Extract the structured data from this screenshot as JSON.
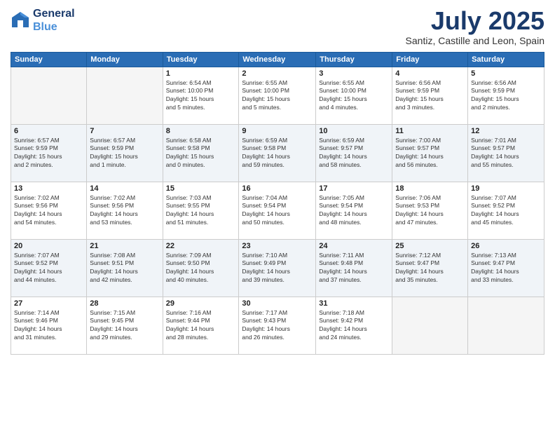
{
  "header": {
    "logo_line1": "General",
    "logo_line2": "Blue",
    "month_title": "July 2025",
    "location": "Santiz, Castille and Leon, Spain"
  },
  "weekdays": [
    "Sunday",
    "Monday",
    "Tuesday",
    "Wednesday",
    "Thursday",
    "Friday",
    "Saturday"
  ],
  "weeks": [
    [
      {
        "day": "",
        "info": ""
      },
      {
        "day": "",
        "info": ""
      },
      {
        "day": "1",
        "info": "Sunrise: 6:54 AM\nSunset: 10:00 PM\nDaylight: 15 hours\nand 5 minutes."
      },
      {
        "day": "2",
        "info": "Sunrise: 6:55 AM\nSunset: 10:00 PM\nDaylight: 15 hours\nand 5 minutes."
      },
      {
        "day": "3",
        "info": "Sunrise: 6:55 AM\nSunset: 10:00 PM\nDaylight: 15 hours\nand 4 minutes."
      },
      {
        "day": "4",
        "info": "Sunrise: 6:56 AM\nSunset: 9:59 PM\nDaylight: 15 hours\nand 3 minutes."
      },
      {
        "day": "5",
        "info": "Sunrise: 6:56 AM\nSunset: 9:59 PM\nDaylight: 15 hours\nand 2 minutes."
      }
    ],
    [
      {
        "day": "6",
        "info": "Sunrise: 6:57 AM\nSunset: 9:59 PM\nDaylight: 15 hours\nand 2 minutes."
      },
      {
        "day": "7",
        "info": "Sunrise: 6:57 AM\nSunset: 9:59 PM\nDaylight: 15 hours\nand 1 minute."
      },
      {
        "day": "8",
        "info": "Sunrise: 6:58 AM\nSunset: 9:58 PM\nDaylight: 15 hours\nand 0 minutes."
      },
      {
        "day": "9",
        "info": "Sunrise: 6:59 AM\nSunset: 9:58 PM\nDaylight: 14 hours\nand 59 minutes."
      },
      {
        "day": "10",
        "info": "Sunrise: 6:59 AM\nSunset: 9:57 PM\nDaylight: 14 hours\nand 58 minutes."
      },
      {
        "day": "11",
        "info": "Sunrise: 7:00 AM\nSunset: 9:57 PM\nDaylight: 14 hours\nand 56 minutes."
      },
      {
        "day": "12",
        "info": "Sunrise: 7:01 AM\nSunset: 9:57 PM\nDaylight: 14 hours\nand 55 minutes."
      }
    ],
    [
      {
        "day": "13",
        "info": "Sunrise: 7:02 AM\nSunset: 9:56 PM\nDaylight: 14 hours\nand 54 minutes."
      },
      {
        "day": "14",
        "info": "Sunrise: 7:02 AM\nSunset: 9:56 PM\nDaylight: 14 hours\nand 53 minutes."
      },
      {
        "day": "15",
        "info": "Sunrise: 7:03 AM\nSunset: 9:55 PM\nDaylight: 14 hours\nand 51 minutes."
      },
      {
        "day": "16",
        "info": "Sunrise: 7:04 AM\nSunset: 9:54 PM\nDaylight: 14 hours\nand 50 minutes."
      },
      {
        "day": "17",
        "info": "Sunrise: 7:05 AM\nSunset: 9:54 PM\nDaylight: 14 hours\nand 48 minutes."
      },
      {
        "day": "18",
        "info": "Sunrise: 7:06 AM\nSunset: 9:53 PM\nDaylight: 14 hours\nand 47 minutes."
      },
      {
        "day": "19",
        "info": "Sunrise: 7:07 AM\nSunset: 9:52 PM\nDaylight: 14 hours\nand 45 minutes."
      }
    ],
    [
      {
        "day": "20",
        "info": "Sunrise: 7:07 AM\nSunset: 9:52 PM\nDaylight: 14 hours\nand 44 minutes."
      },
      {
        "day": "21",
        "info": "Sunrise: 7:08 AM\nSunset: 9:51 PM\nDaylight: 14 hours\nand 42 minutes."
      },
      {
        "day": "22",
        "info": "Sunrise: 7:09 AM\nSunset: 9:50 PM\nDaylight: 14 hours\nand 40 minutes."
      },
      {
        "day": "23",
        "info": "Sunrise: 7:10 AM\nSunset: 9:49 PM\nDaylight: 14 hours\nand 39 minutes."
      },
      {
        "day": "24",
        "info": "Sunrise: 7:11 AM\nSunset: 9:48 PM\nDaylight: 14 hours\nand 37 minutes."
      },
      {
        "day": "25",
        "info": "Sunrise: 7:12 AM\nSunset: 9:47 PM\nDaylight: 14 hours\nand 35 minutes."
      },
      {
        "day": "26",
        "info": "Sunrise: 7:13 AM\nSunset: 9:47 PM\nDaylight: 14 hours\nand 33 minutes."
      }
    ],
    [
      {
        "day": "27",
        "info": "Sunrise: 7:14 AM\nSunset: 9:46 PM\nDaylight: 14 hours\nand 31 minutes."
      },
      {
        "day": "28",
        "info": "Sunrise: 7:15 AM\nSunset: 9:45 PM\nDaylight: 14 hours\nand 29 minutes."
      },
      {
        "day": "29",
        "info": "Sunrise: 7:16 AM\nSunset: 9:44 PM\nDaylight: 14 hours\nand 28 minutes."
      },
      {
        "day": "30",
        "info": "Sunrise: 7:17 AM\nSunset: 9:43 PM\nDaylight: 14 hours\nand 26 minutes."
      },
      {
        "day": "31",
        "info": "Sunrise: 7:18 AM\nSunset: 9:42 PM\nDaylight: 14 hours\nand 24 minutes."
      },
      {
        "day": "",
        "info": ""
      },
      {
        "day": "",
        "info": ""
      }
    ]
  ]
}
